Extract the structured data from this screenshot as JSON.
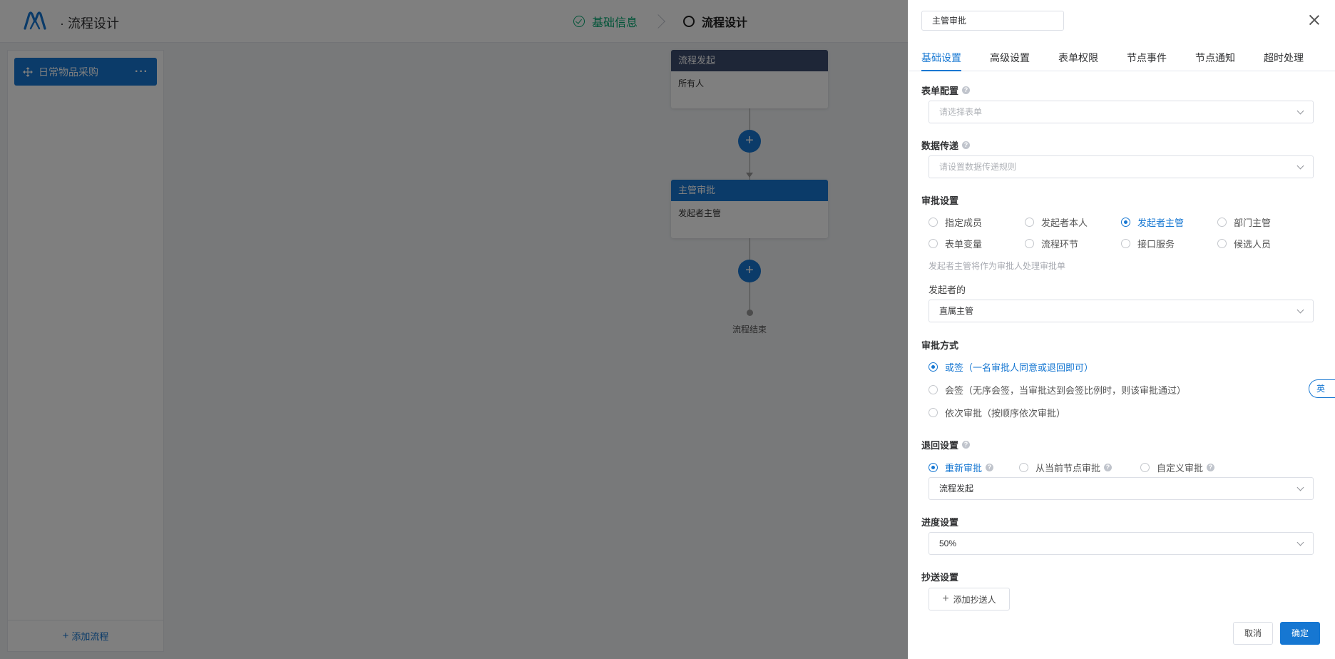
{
  "header": {
    "app_title": "· 流程设计",
    "steps": [
      {
        "label": "基础信息",
        "state": "done"
      },
      {
        "label": "流程设计",
        "state": "active"
      }
    ]
  },
  "sidebar": {
    "flow_item_label": "日常物品采购",
    "flow_item_more": "···",
    "add_flow_label": "添加流程"
  },
  "canvas": {
    "nodes": [
      {
        "title": "流程发起",
        "body": "所有人",
        "header_color": "#3d4c6e"
      },
      {
        "title": "主管审批",
        "body": "发起者主管",
        "header_color": "#1677d2"
      }
    ],
    "add_symbol": "+",
    "end_label": "流程结束"
  },
  "drawer": {
    "node_name": "主管审批",
    "tabs": [
      "基础设置",
      "高级设置",
      "表单权限",
      "节点事件",
      "节点通知",
      "超时处理"
    ],
    "active_tab": "基础设置",
    "form_config": {
      "title": "表单配置",
      "placeholder": "请选择表单"
    },
    "data_transfer": {
      "title": "数据传递",
      "placeholder": "请设置数据传递规则"
    },
    "approval_settings": {
      "title": "审批设置",
      "options": [
        "指定成员",
        "发起者本人",
        "发起者主管",
        "部门主管",
        "表单变量",
        "流程环节",
        "接口服务",
        "候选人员"
      ],
      "selected": "发起者主管",
      "hint": "发起者主管将作为审批人处理审批单",
      "initiator_label": "发起者的",
      "initiator_value": "直属主管"
    },
    "approval_method": {
      "title": "审批方式",
      "options": [
        "或签（一名审批人同意或退回即可）",
        "会签（无序会签，当审批达到会签比例时，则该审批通过）",
        "依次审批（按顺序依次审批）"
      ],
      "selected": "或签（一名审批人同意或退回即可）"
    },
    "return_settings": {
      "title": "退回设置",
      "options": [
        "重新审批",
        "从当前节点审批",
        "自定义审批"
      ],
      "selected": "重新审批",
      "value": "流程发起"
    },
    "progress_settings": {
      "title": "进度设置",
      "value": "50%"
    },
    "cc_settings": {
      "title": "抄送设置",
      "add_label": "添加抄送人"
    },
    "cancel_label": "取消",
    "confirm_label": "确定",
    "ime_indicator": "英"
  },
  "colors": {
    "primary": "#1677d2",
    "success": "#00a870",
    "node_start_header": "#3d4c6e"
  }
}
